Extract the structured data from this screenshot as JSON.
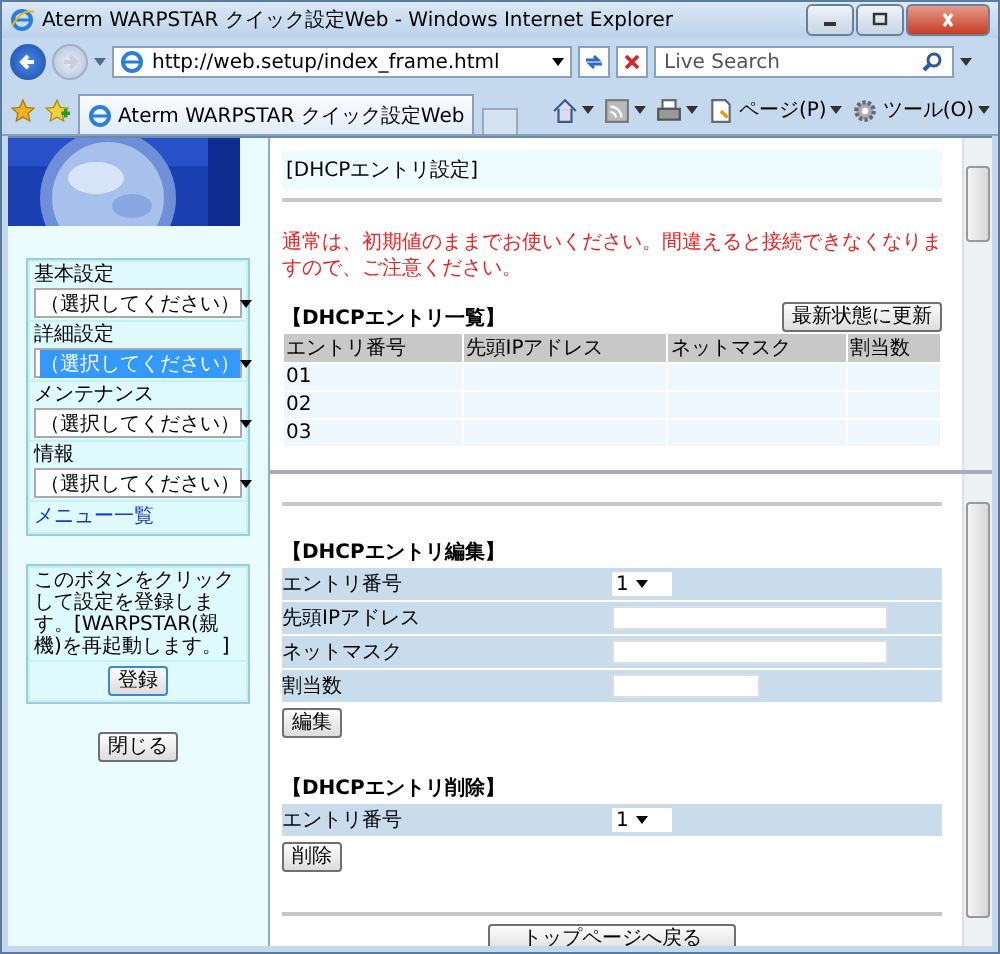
{
  "window": {
    "title": "Aterm WARPSTAR クイック設定Web - Windows Internet Explorer"
  },
  "address_bar": {
    "url": "http://web.setup/index_frame.html"
  },
  "search": {
    "placeholder": "Live Search"
  },
  "tab": {
    "title": "Aterm WARPSTAR クイック設定Web"
  },
  "toolbar": [
    {
      "kind": "home"
    },
    {
      "kind": "feed"
    },
    {
      "kind": "print"
    },
    {
      "kind": "page",
      "label": "ページ(P)"
    },
    {
      "kind": "tools",
      "label": "ツール(O)"
    }
  ],
  "sidebar": {
    "menus": [
      {
        "label": "基本設定",
        "value": "（選択してください）",
        "selected": false
      },
      {
        "label": "詳細設定",
        "value": "（選択してください）",
        "selected": true
      },
      {
        "label": "メンテナンス",
        "value": "（選択してください）",
        "selected": false
      },
      {
        "label": "情報",
        "value": "（選択してください）",
        "selected": false
      }
    ],
    "link": "メニュー一覧",
    "note": "このボタンをクリックして設定を登録します。[WARPSTAR(親機)を再起動します。]",
    "register_button": "登録",
    "close_button": "閉じる"
  },
  "top_frame": {
    "title": "[DHCPエントリ設定]",
    "warning": "通常は、初期値のままでお使いください。間違えると接続できなくなりますので、ご注意ください。",
    "list_title": "【DHCPエントリ一覧】",
    "refresh_button": "最新状態に更新",
    "table": {
      "columns": [
        "エントリ番号",
        "先頭IPアドレス",
        "ネットマスク",
        "割当数"
      ],
      "rows": [
        {
          "number": "01"
        },
        {
          "number": "02"
        },
        {
          "number": "03"
        }
      ]
    }
  },
  "bottom_frame": {
    "edit_title": "【DHCPエントリ編集】",
    "edit_fields": [
      {
        "label": "エントリ番号",
        "kind": "select",
        "value": "1"
      },
      {
        "label": "先頭IPアドレス",
        "kind": "text"
      },
      {
        "label": "ネットマスク",
        "kind": "text"
      },
      {
        "label": "割当数",
        "kind": "short"
      }
    ],
    "edit_button": "編集",
    "delete_title": "【DHCPエントリ削除】",
    "delete_fields": [
      {
        "label": "エントリ番号",
        "kind": "select",
        "value": "1"
      }
    ],
    "delete_button": "削除",
    "top_button": "トップページへ戻る"
  }
}
